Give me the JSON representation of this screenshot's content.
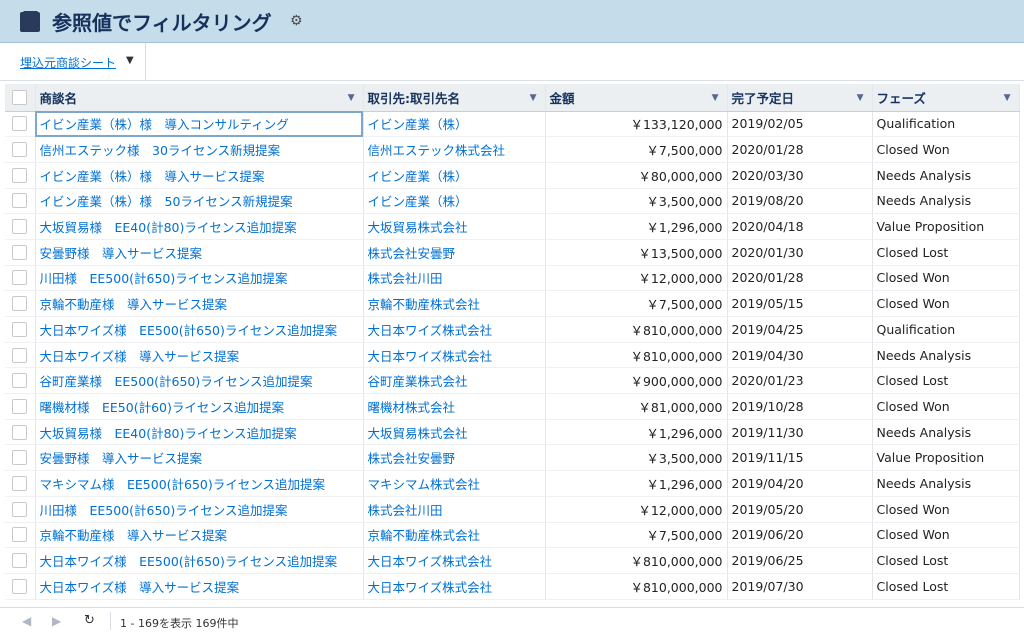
{
  "header": {
    "title": "参照値でフィルタリング",
    "settings_icon": "gear-icon"
  },
  "toolbar": {
    "sheet_label": "埋込元商談シート"
  },
  "columns": {
    "deal": "商談名",
    "account": "取引先:取引先名",
    "amount": "金額",
    "close_date": "完了予定日",
    "phase": "フェーズ"
  },
  "rows": [
    {
      "deal": "イビン産業（株）様　導入コンサルティング",
      "account": "イビン産業（株）",
      "amount": "￥133,120,000",
      "date": "2019/02/05",
      "phase": "Qualification"
    },
    {
      "deal": "信州エステック様　30ライセンス新規提案",
      "account": "信州エステック株式会社",
      "amount": "￥7,500,000",
      "date": "2020/01/28",
      "phase": "Closed Won"
    },
    {
      "deal": "イビン産業（株）様　導入サービス提案",
      "account": "イビン産業（株）",
      "amount": "￥80,000,000",
      "date": "2020/03/30",
      "phase": "Needs Analysis"
    },
    {
      "deal": "イビン産業（株）様　50ライセンス新規提案",
      "account": "イビン産業（株）",
      "amount": "￥3,500,000",
      "date": "2019/08/20",
      "phase": "Needs Analysis"
    },
    {
      "deal": "大坂貿易様　EE40(計80)ライセンス追加提案",
      "account": "大坂貿易株式会社",
      "amount": "￥1,296,000",
      "date": "2020/04/18",
      "phase": "Value Proposition"
    },
    {
      "deal": "安曇野様　導入サービス提案",
      "account": "株式会社安曇野",
      "amount": "￥13,500,000",
      "date": "2020/01/30",
      "phase": "Closed Lost"
    },
    {
      "deal": "川田様　EE500(計650)ライセンス追加提案",
      "account": "株式会社川田",
      "amount": "￥12,000,000",
      "date": "2020/01/28",
      "phase": "Closed Won"
    },
    {
      "deal": "京輪不動産様　導入サービス提案",
      "account": "京輪不動産株式会社",
      "amount": "￥7,500,000",
      "date": "2019/05/15",
      "phase": "Closed Won"
    },
    {
      "deal": "大日本ワイズ様　EE500(計650)ライセンス追加提案",
      "account": "大日本ワイズ株式会社",
      "amount": "￥810,000,000",
      "date": "2019/04/25",
      "phase": "Qualification"
    },
    {
      "deal": "大日本ワイズ様　導入サービス提案",
      "account": "大日本ワイズ株式会社",
      "amount": "￥810,000,000",
      "date": "2019/04/30",
      "phase": "Needs Analysis"
    },
    {
      "deal": "谷町産業様　EE500(計650)ライセンス追加提案",
      "account": "谷町産業株式会社",
      "amount": "￥900,000,000",
      "date": "2020/01/23",
      "phase": "Closed Lost"
    },
    {
      "deal": "曙機材様　EE50(計60)ライセンス追加提案",
      "account": "曙機材株式会社",
      "amount": "￥81,000,000",
      "date": "2019/10/28",
      "phase": "Closed Won"
    },
    {
      "deal": "大坂貿易様　EE40(計80)ライセンス追加提案",
      "account": "大坂貿易株式会社",
      "amount": "￥1,296,000",
      "date": "2019/11/30",
      "phase": "Needs Analysis"
    },
    {
      "deal": "安曇野様　導入サービス提案",
      "account": "株式会社安曇野",
      "amount": "￥3,500,000",
      "date": "2019/11/15",
      "phase": "Value Proposition"
    },
    {
      "deal": "マキシマム様　EE500(計650)ライセンス追加提案",
      "account": "マキシマム株式会社",
      "amount": "￥1,296,000",
      "date": "2019/04/20",
      "phase": "Needs Analysis"
    },
    {
      "deal": "川田様　EE500(計650)ライセンス追加提案",
      "account": "株式会社川田",
      "amount": "￥12,000,000",
      "date": "2019/05/20",
      "phase": "Closed Won"
    },
    {
      "deal": "京輪不動産様　導入サービス提案",
      "account": "京輪不動産株式会社",
      "amount": "￥7,500,000",
      "date": "2019/06/20",
      "phase": "Closed Won"
    },
    {
      "deal": "大日本ワイズ様　EE500(計650)ライセンス追加提案",
      "account": "大日本ワイズ株式会社",
      "amount": "￥810,000,000",
      "date": "2019/06/25",
      "phase": "Closed Lost"
    },
    {
      "deal": "大日本ワイズ様　導入サービス提案",
      "account": "大日本ワイズ株式会社",
      "amount": "￥810,000,000",
      "date": "2019/07/30",
      "phase": "Closed Lost"
    }
  ],
  "footer": {
    "count_text": "1 - 169を表示 169件中"
  }
}
